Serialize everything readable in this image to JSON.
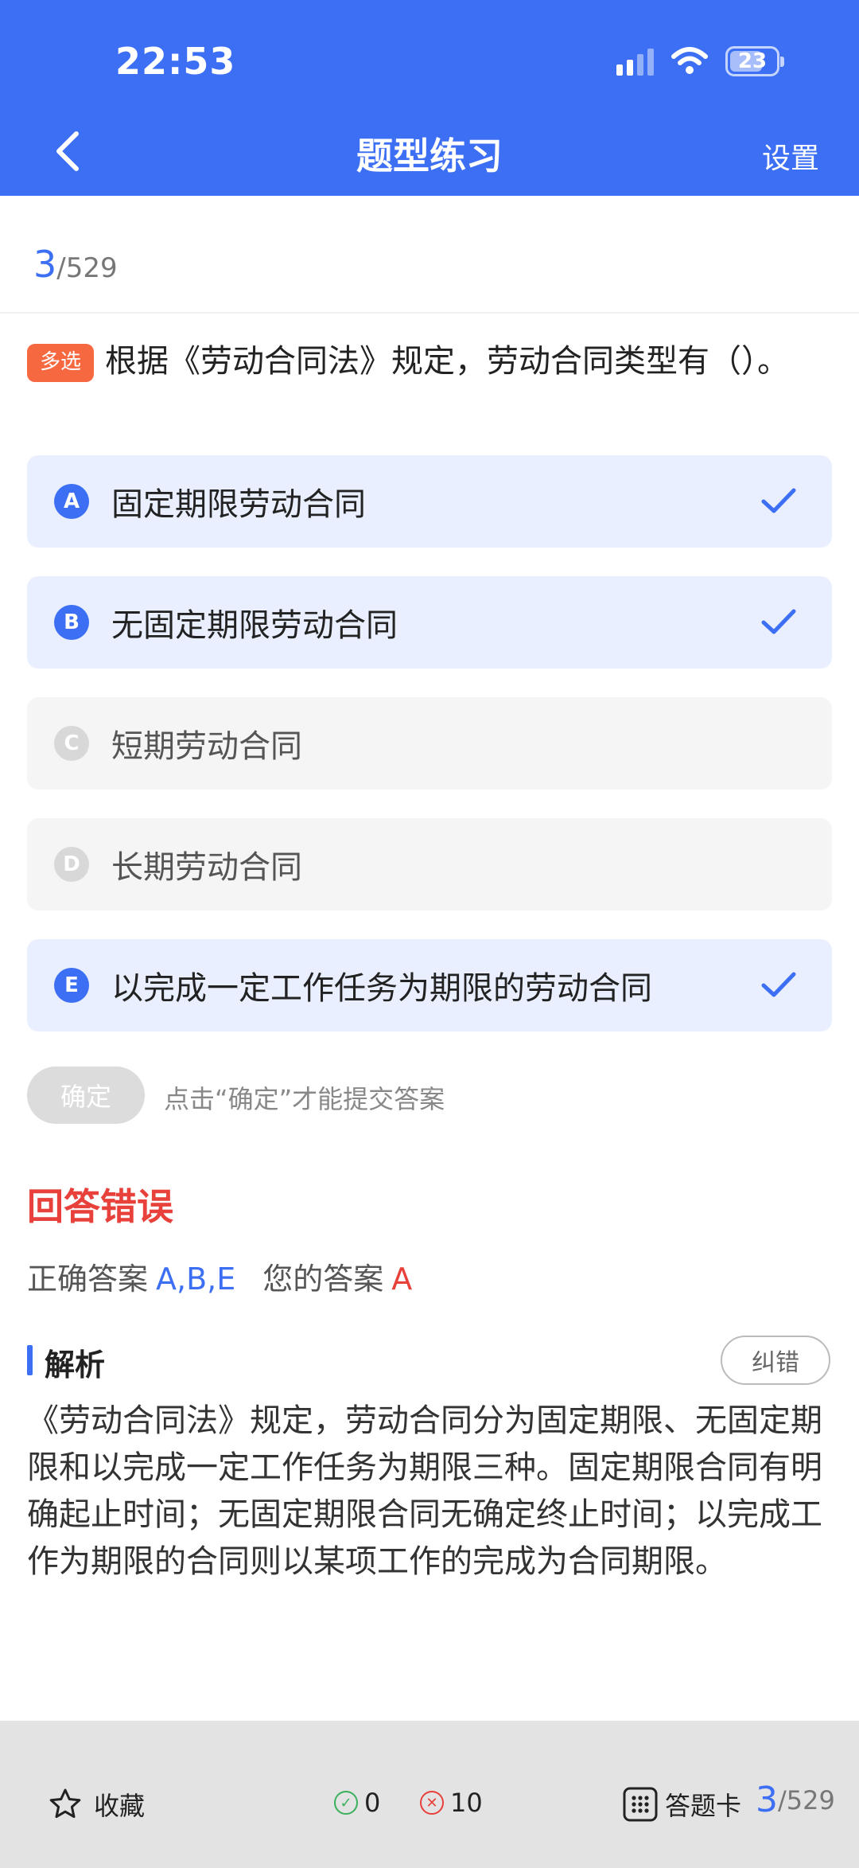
{
  "status": {
    "time": "22:53",
    "battery": "23"
  },
  "header": {
    "title": "题型练习",
    "settings": "设置"
  },
  "progress": {
    "current": "3",
    "total": "/529"
  },
  "question": {
    "type": "多选",
    "text": "根据《劳动合同法》规定，劳动合同类型有（）。"
  },
  "options": [
    {
      "letter": "A",
      "text": "固定期限劳动合同",
      "selected": true
    },
    {
      "letter": "B",
      "text": "无固定期限劳动合同",
      "selected": true
    },
    {
      "letter": "C",
      "text": "短期劳动合同",
      "selected": false
    },
    {
      "letter": "D",
      "text": "长期劳动合同",
      "selected": false
    },
    {
      "letter": "E",
      "text": "以完成一定工作任务为期限的劳动合同",
      "selected": true
    }
  ],
  "confirm": {
    "label": "确定",
    "hint": "点击“确定”才能提交答案"
  },
  "result": {
    "status": "回答错误",
    "correct_label": "正确答案",
    "correct_value": "A,B,E",
    "yours_label": "您的答案",
    "yours_value": "A"
  },
  "analysis": {
    "title": "解析",
    "report": "纠错",
    "text": "《劳动合同法》规定，劳动合同分为固定期限、无固定期限和以完成一定工作任务为期限三种。固定期限合同有明确起止时间；无固定期限合同无确定终止时间；以完成工作为期限的合同则以某项工作的完成为合同期限。"
  },
  "bottom": {
    "favorite": "收藏",
    "right_count": "0",
    "wrong_count": "10",
    "card": "答题卡",
    "current": "3",
    "total": "/529"
  },
  "colors": {
    "accent": "#3c6ff3",
    "error": "#e8403a",
    "qtype": "#f6683f"
  },
  "icons": [
    "back-arrow-icon",
    "signal-icon",
    "wifi-icon",
    "battery-icon",
    "check-icon",
    "star-icon",
    "check-circle-icon",
    "x-circle-icon",
    "grid-icon"
  ]
}
